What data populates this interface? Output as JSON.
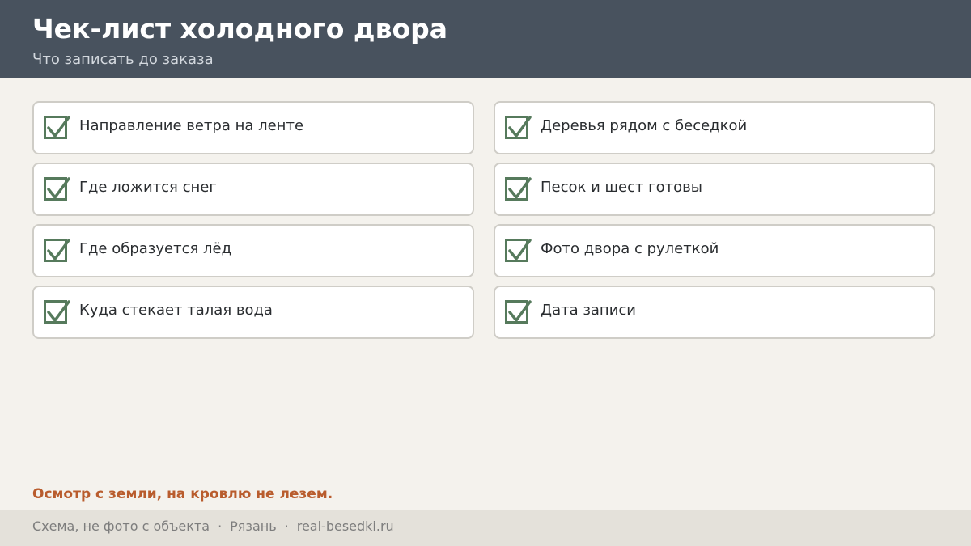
{
  "header": {
    "title": "Чек-лист холодного двора",
    "subtitle": "Что записать до заказа"
  },
  "checklist": {
    "left": [
      {
        "label": "Направление ветра на ленте",
        "checked": true
      },
      {
        "label": "Где ложится снег",
        "checked": true
      },
      {
        "label": "Где образуется лёд",
        "checked": true
      },
      {
        "label": "Куда стекает талая вода",
        "checked": true
      }
    ],
    "right": [
      {
        "label": "Деревья рядом с беседкой",
        "checked": true
      },
      {
        "label": "Песок и шест готовы",
        "checked": true
      },
      {
        "label": "Фото двора с рулеткой",
        "checked": true
      },
      {
        "label": "Дата записи",
        "checked": true
      }
    ]
  },
  "note": "Осмотр с земли, на кровлю не лезем.",
  "footer": {
    "items": [
      "Схема, не фото с объекта",
      "Рязань",
      "real-besedki.ru"
    ],
    "separator": "·"
  },
  "colors": {
    "header_bg": "#48525e",
    "page_bg": "#f4f2ed",
    "check": "#567a5c",
    "accent": "#b95c2d",
    "footer_bg": "#e4e1da"
  },
  "icons": {
    "checkbox": "checkmark-icon"
  }
}
